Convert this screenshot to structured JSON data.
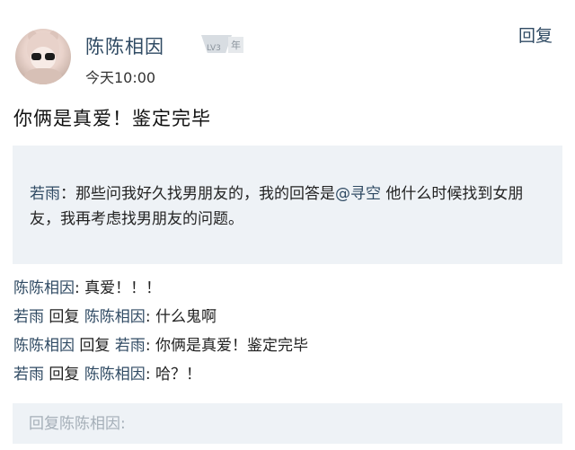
{
  "comment": {
    "username": "陈陈相因",
    "level_badge": {
      "lv": "LV3",
      "year": "年"
    },
    "time": "今天10:00",
    "reply_label": "回复",
    "text": "你俩是真爱！鉴定完毕"
  },
  "quote": {
    "author": "若雨",
    "colon": "：",
    "text_before": "那些问我好久找男朋友的，我的回答是",
    "mention": "@寻空",
    "text_after": " 他什么时候找到女朋友，我再考虑找男朋友的问题。"
  },
  "sub_replies": [
    {
      "from": "陈陈相因",
      "reply_word": "",
      "to": "",
      "text": ": 真爱！！！"
    },
    {
      "from": "若雨",
      "reply_word": " 回复 ",
      "to": "陈陈相因",
      "text": ": 什么鬼啊"
    },
    {
      "from": "陈陈相因",
      "reply_word": " 回复 ",
      "to": "若雨",
      "text": ": 你俩是真爱！鉴定完毕"
    },
    {
      "from": "若雨",
      "reply_word": " 回复 ",
      "to": "陈陈相因",
      "text": ": 哈？！"
    }
  ],
  "reply_input": {
    "placeholder": "回复陈陈相因:"
  },
  "colors": {
    "link": "#2f4a63",
    "quote_bg": "#eef2f6"
  }
}
